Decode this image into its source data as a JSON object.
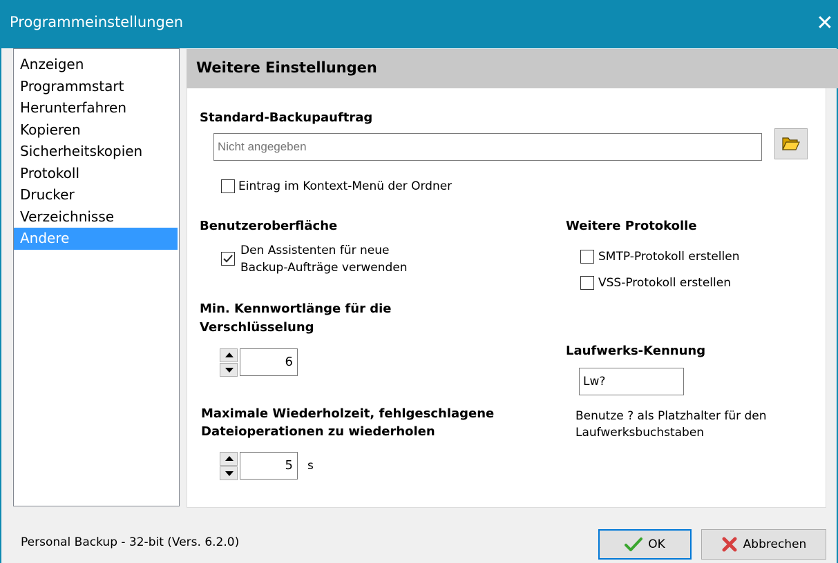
{
  "window": {
    "title": "Programmeinstellungen",
    "close_glyph": "✕"
  },
  "nav": {
    "items": [
      {
        "label": "Anzeigen",
        "selected": false
      },
      {
        "label": "Programmstart",
        "selected": false
      },
      {
        "label": "Herunterfahren",
        "selected": false
      },
      {
        "label": "Kopieren",
        "selected": false
      },
      {
        "label": "Sicherheitskopien",
        "selected": false
      },
      {
        "label": "Protokoll",
        "selected": false
      },
      {
        "label": "Drucker",
        "selected": false
      },
      {
        "label": "Verzeichnisse",
        "selected": false
      },
      {
        "label": "Andere",
        "selected": true
      }
    ]
  },
  "panel": {
    "header": "Weitere Einstellungen",
    "backup": {
      "label": "Standard-Backupauftrag",
      "value": "",
      "placeholder": "Nicht angegeben",
      "folder_icon": "folder-open-icon",
      "context_menu_label": "Eintrag im Kontext-Menü der Ordner",
      "context_menu_checked": false
    },
    "ui": {
      "label": "Benutzeroberfläche",
      "assistant_label_line1": "Den Assistenten für neue",
      "assistant_label_line2": "Backup-Aufträge verwenden",
      "assistant_checked": true
    },
    "protocols": {
      "label": "Weitere Protokolle",
      "smtp_label": "SMTP-Protokoll erstellen",
      "smtp_checked": false,
      "vss_label": "VSS-Protokoll erstellen",
      "vss_checked": false
    },
    "password": {
      "label_line1": "Min. Kennwortlänge für die",
      "label_line2": "Verschlüsselung",
      "value": "6"
    },
    "drive": {
      "label": "Laufwerks-Kennung",
      "value": "Lw?",
      "hint_line1": "Benutze ? als Platzhalter für den",
      "hint_line2": "Laufwerksbuchstaben"
    },
    "retry": {
      "label_line1": "Maximale Wiederholzeit, fehlgeschlagene",
      "label_line2": "Dateioperationen zu wiederholen",
      "value": "5",
      "unit": "s"
    }
  },
  "footer": {
    "status": "Personal Backup - 32-bit (Vers. 6.2.0)",
    "ok_label": "OK",
    "cancel_label": "Abbrechen"
  },
  "colors": {
    "titlebar": "#0e8ab1",
    "selection": "#3399ff",
    "ok_check": "#3aa62f",
    "cancel_x": "#d64040"
  }
}
